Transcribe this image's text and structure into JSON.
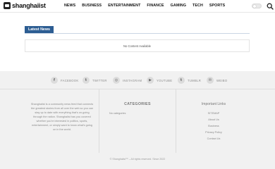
{
  "header": {
    "logo_text": "shanghaiist",
    "nav": [
      "NEWS",
      "BUSINESS",
      "ENTERTAINMENT",
      "FINANCE",
      "GAMING",
      "TECH",
      "SPORTS"
    ]
  },
  "latest": {
    "title": "Latest News",
    "empty_text": "No Content Available"
  },
  "footer": {
    "social": [
      {
        "icon": "f",
        "label": "FACEBOOK"
      },
      {
        "icon": "t",
        "label": "TWITTER"
      },
      {
        "icon": "◎",
        "label": "INSTAGRAM"
      },
      {
        "icon": "▶",
        "label": "YOUTUBE"
      },
      {
        "icon": "t",
        "label": "TUMBLR"
      },
      {
        "icon": "✉",
        "label": "WEIBO"
      }
    ],
    "about_text": "Shanghaiist is a community news feed that connects the greatest stories from all over the web so you can stay up to date with everything that's on-going through the nation. Shanghaiist has you covered whether you're interested in politics, sports, entertainment, or simply want to know what's going on in the world.",
    "categories_title": "CATEGORIES",
    "categories_text": "No categories",
    "links_title": "Important Links",
    "links": [
      "SITEMAP",
      "About Us",
      "Business",
      "Privacy Policy",
      "Contact Us"
    ],
    "copyright": "© Shanghaiist™ – All rights reserved. Since 2022"
  }
}
